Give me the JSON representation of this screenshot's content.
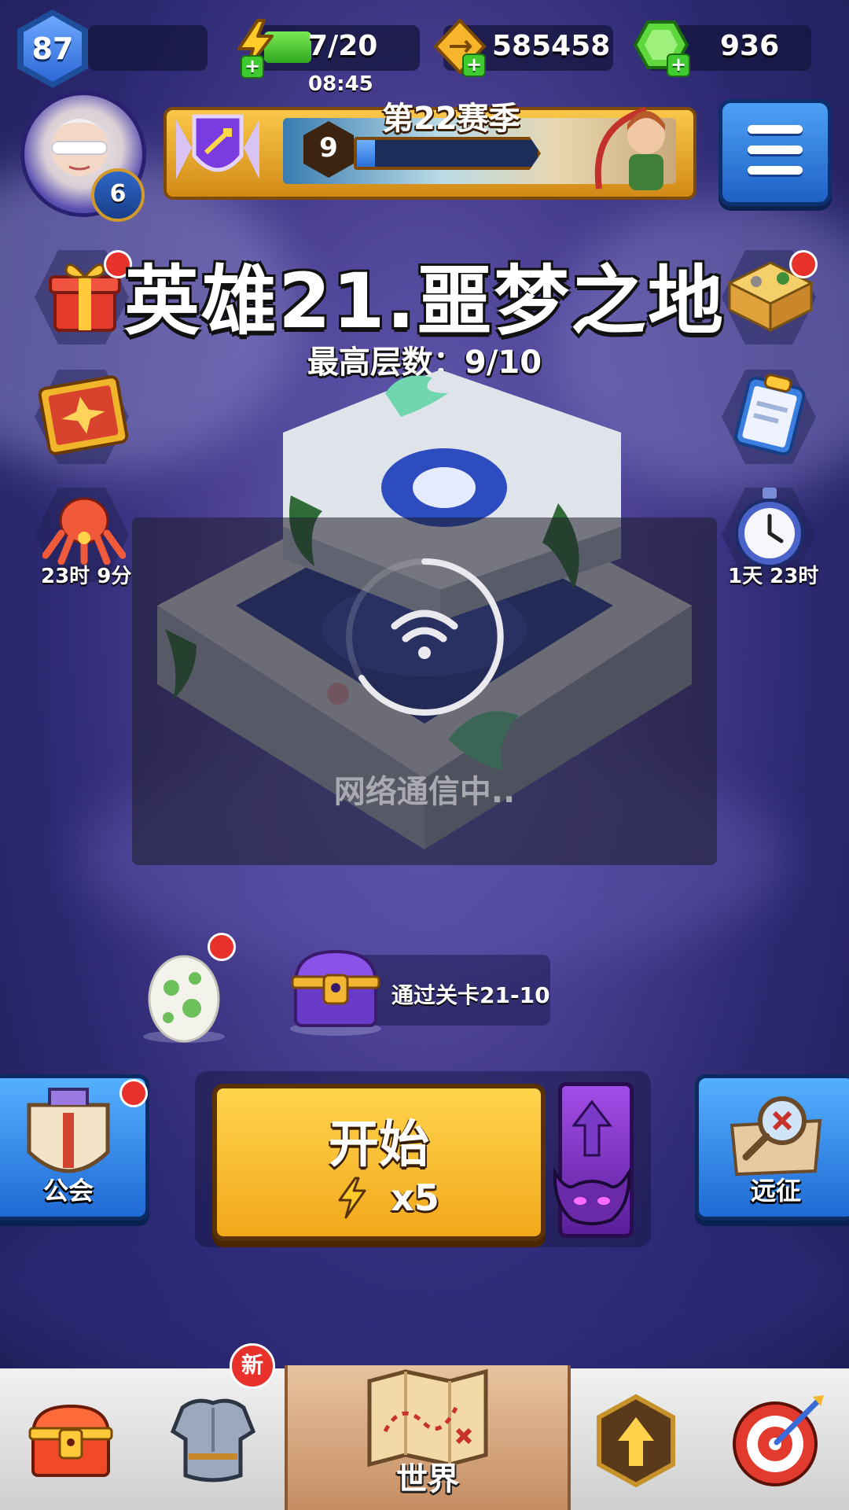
{
  "player": {
    "level": "87",
    "hero_level": "6"
  },
  "resources": {
    "energy": "7/20",
    "energy_timer": "08:45",
    "gold": "585458",
    "gems": "936"
  },
  "season": {
    "title": "第22赛季",
    "tier": "9",
    "progress": 0.1
  },
  "stage": {
    "title": "英雄21.噩梦之地",
    "best_floor": "最高层数：9/10"
  },
  "side_events": {
    "left_timer": "23时 9分",
    "right_timer": "1天 23时"
  },
  "loading": {
    "text": "网络通信中.."
  },
  "reward": {
    "chest_label": "通过关卡21-10"
  },
  "actions": {
    "start_label": "开始",
    "start_cost": "x5",
    "guild_label": "公会",
    "expedition_label": "远征"
  },
  "nav": {
    "new_badge": "新",
    "world_label": "世界"
  },
  "colors": {
    "accent_gold": "#f2a81b",
    "accent_blue": "#1f6ad4",
    "energy_green": "#3fca2f"
  }
}
